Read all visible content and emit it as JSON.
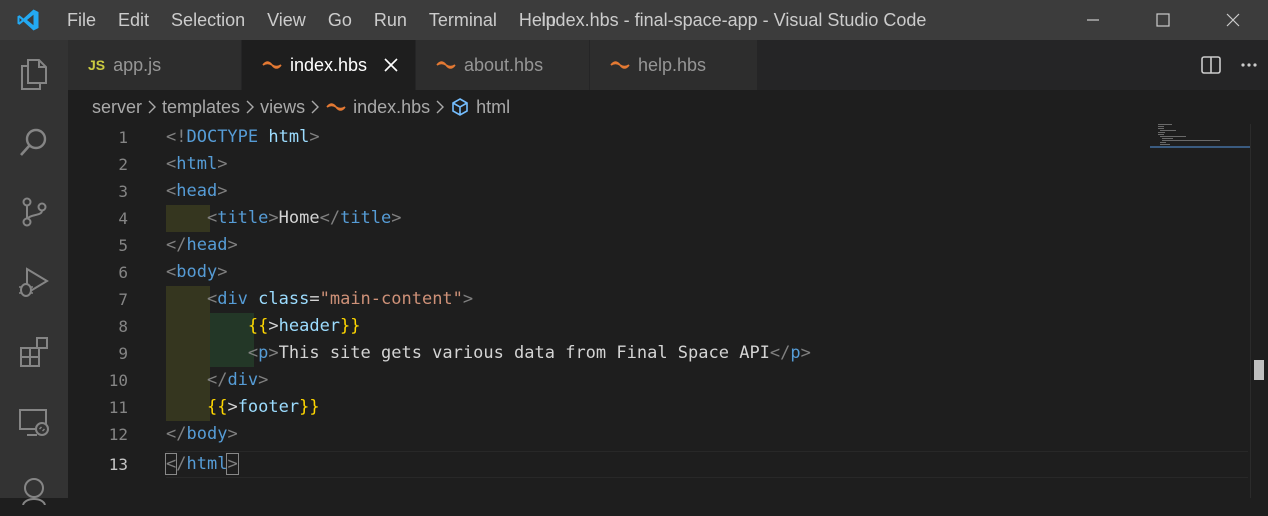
{
  "titlebar": {
    "menu": [
      "File",
      "Edit",
      "Selection",
      "View",
      "Go",
      "Run",
      "Terminal",
      "Help"
    ],
    "title": "index.hbs - final-space-app - Visual Studio Code",
    "logo_icon": "vscode-logo-icon",
    "controls": [
      "minimize-icon",
      "maximize-icon",
      "close-icon"
    ]
  },
  "activitybar": {
    "items": [
      "explorer-icon",
      "search-icon",
      "source-control-icon",
      "run-debug-icon",
      "extensions-icon",
      "remote-explorer-icon",
      "account-icon"
    ]
  },
  "tabs": [
    {
      "label": "app.js",
      "icon": "js",
      "active": false
    },
    {
      "label": "index.hbs",
      "icon": "handlebars-icon",
      "active": true
    },
    {
      "label": "about.hbs",
      "icon": "handlebars-icon",
      "active": false
    },
    {
      "label": "help.hbs",
      "icon": "handlebars-icon",
      "active": false
    }
  ],
  "tab_actions": [
    "split-editor-icon",
    "more-actions-icon"
  ],
  "breadcrumb": [
    "server",
    "templates",
    "views",
    "index.hbs",
    "html"
  ],
  "editor": {
    "current_line": 13,
    "lines": [
      "<!DOCTYPE html>",
      "<html>",
      "<head>",
      "    <title>Home</title>",
      "</head>",
      "<body>",
      "    <div class=\"main-content\">",
      "        {{>header}}",
      "        <p>This site gets various data from Final Space API</p>",
      "    </div>",
      "    {{>footer}}",
      "</body>",
      "</html>"
    ]
  },
  "colors": {
    "tag": "#569cd6",
    "bracket": "#808080",
    "attr": "#9cdcfe",
    "string": "#ce9178",
    "handlebars": "#ffd700",
    "hbs_icon": "#e37933"
  }
}
